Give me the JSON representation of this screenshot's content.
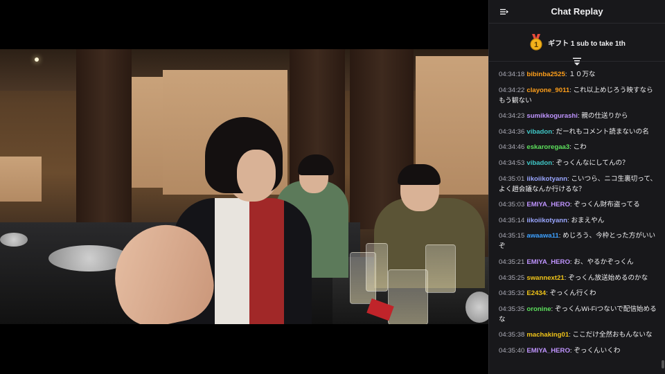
{
  "chat": {
    "title": "Chat Replay",
    "gift_text": "ギフト 1 sub to take 1th",
    "gift_rank": "1",
    "icons": {
      "collapse": "collapse-icon",
      "filter": "filter-icon",
      "gift_badge": "rank-badge-icon"
    },
    "messages": [
      {
        "time": "04:34:18",
        "user": "bibinba2525",
        "color": "#ff9f1a",
        "text": "１０万な"
      },
      {
        "time": "04:34:22",
        "user": "clayone_9011",
        "color": "#ff9f1a",
        "text": "これ以上めじろう映すなら\nもう観ない"
      },
      {
        "time": "04:34:23",
        "user": "sumikkogurashi",
        "color": "#bf94ff",
        "text": "親の仕送りから"
      },
      {
        "time": "04:34:36",
        "user": "vibadon",
        "color": "#3fc7c7",
        "text": "だーれもコメント読まないの名"
      },
      {
        "time": "04:34:46",
        "user": "eskaroregaa3",
        "color": "#5de05d",
        "text": "こわ"
      },
      {
        "time": "04:34:53",
        "user": "vibadon",
        "color": "#3fc7c7",
        "text": "ぞっくんなにしてんの？"
      },
      {
        "time": "04:35:01",
        "user": "iikoiikotyann",
        "color": "#9aa6ff",
        "text": "こいつら、ニコ生裏切って、よく趙会議なんか行けるな？"
      },
      {
        "time": "04:35:03",
        "user": "EMIYA_HERO",
        "color": "#bf94ff",
        "text": "ぞっくん財布盗ってる"
      },
      {
        "time": "04:35:14",
        "user": "iikoiikotyann",
        "color": "#9aa6ff",
        "text": "おまえやん"
      },
      {
        "time": "04:35:15",
        "user": "awaawa11",
        "color": "#3ca0ff",
        "text": "めじろう、今枠とった方がいいぞ"
      },
      {
        "time": "04:35:21",
        "user": "EMIYA_HERO",
        "color": "#bf94ff",
        "text": "お、やるかぞっくん"
      },
      {
        "time": "04:35:25",
        "user": "swannext21",
        "color": "#f0c419",
        "text": "ぞっくん放送始めるのかな"
      },
      {
        "time": "04:35:32",
        "user": "E2434",
        "color": "#f0c419",
        "text": "ぞっくん行くわ"
      },
      {
        "time": "04:35:35",
        "user": "oronine",
        "color": "#5de05d",
        "text": "ぞっくんWi‐Fiつないで配信始めるな"
      },
      {
        "time": "04:35:38",
        "user": "machaking01",
        "color": "#f0c419",
        "text": "ここだけ全然おもんないな"
      },
      {
        "time": "04:35:40",
        "user": "EMIYA_HERO",
        "color": "#bf94ff",
        "text": "ぞっくんいくわ"
      }
    ]
  }
}
